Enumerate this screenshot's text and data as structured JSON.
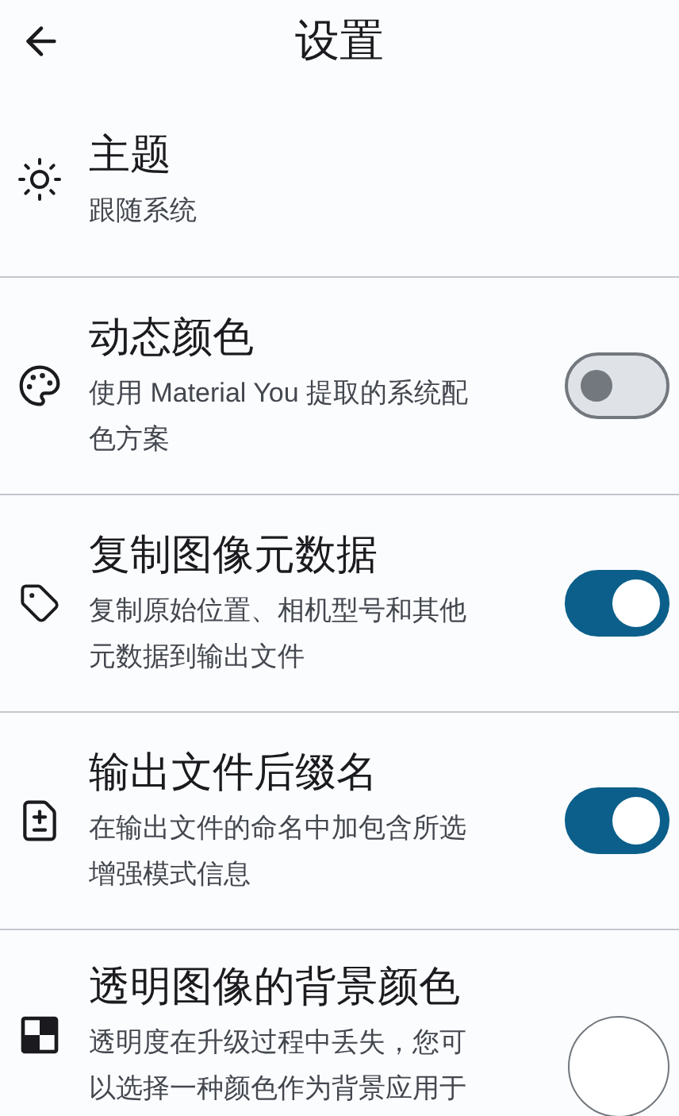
{
  "title": "设置",
  "settings": [
    {
      "kind": "plain",
      "title": "主题",
      "subtitle": [
        "跟随系统"
      ]
    },
    {
      "kind": "toggle",
      "title": "动态颜色",
      "subtitle": [
        "使用 Material You 提取的系统配",
        "色方案"
      ],
      "on": false
    },
    {
      "kind": "toggle",
      "title": "复制图像元数据",
      "subtitle": [
        "复制原始位置、相机型号和其他",
        "元数据到输出文件"
      ],
      "on": true
    },
    {
      "kind": "toggle",
      "title": "输出文件后缀名",
      "subtitle": [
        "在输出文件的命名中加包含所选",
        "增强模式信息"
      ],
      "on": true
    },
    {
      "kind": "color",
      "title": "透明图像的背景颜色",
      "subtitle": [
        "透明度在升级过程中丢失，您可",
        "以选择一种颜色作为背景应用于"
      ],
      "color": "#ffffff"
    }
  ]
}
